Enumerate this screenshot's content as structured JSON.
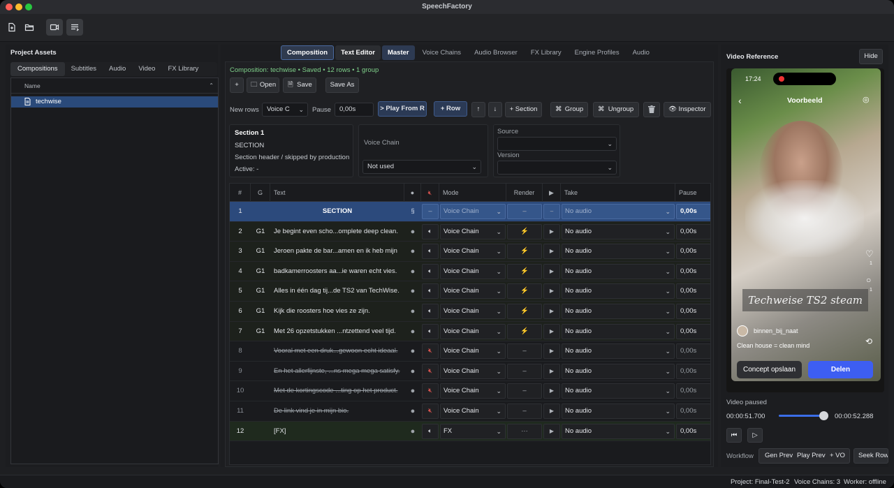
{
  "app": {
    "title": "SpeechFactory"
  },
  "colors": {
    "accent": "#3b6ee8",
    "status_green": "#7fd08a",
    "selected_row": "#2c4a7c",
    "fx_row": "#1f2a1e"
  },
  "toolbar": {
    "icons": [
      "new-file-icon",
      "open-folder-icon",
      "video-camera-icon",
      "list-icon"
    ]
  },
  "assets": {
    "title": "Project Assets",
    "tabs": [
      "Compositions",
      "Subtitles",
      "Audio",
      "Video",
      "FX Library"
    ],
    "column": "Name",
    "items": [
      "techwise"
    ]
  },
  "center": {
    "tabs": [
      "Composition",
      "Text Editor",
      "Master",
      "Voice Chains",
      "Audio Browser",
      "FX Library",
      "Engine Profiles",
      "Audio"
    ],
    "status": "Composition: techwise • Saved • 12 rows • 1 group",
    "buttons": {
      "plus": "+",
      "open": "Open",
      "save": "Save",
      "save_as": "Save As"
    },
    "newrows": {
      "label": "New rows",
      "voice_value": "Voice C",
      "pause_label": "Pause",
      "pause_value": "0,00s",
      "play_from": "> Play From R",
      "row": "+ Row",
      "up": "↑",
      "down": "↓",
      "section": "+ Section",
      "group": "Group",
      "ungroup": "Ungroup",
      "inspector": "Inspector"
    },
    "info": {
      "title": "Section 1",
      "type": "SECTION",
      "desc": "Section header / skipped by production",
      "active": "Active: -",
      "voice_chain_label": "Voice Chain",
      "voice_chain_value": "Not used",
      "source_label": "Source",
      "version_label": "Version"
    },
    "columns": [
      "#",
      "G",
      "Text",
      "Mode",
      "Render",
      "Take",
      "Pause"
    ],
    "rows": [
      {
        "n": "1",
        "g": "",
        "text": "SECTION",
        "mode": "Voice Chain",
        "render": "–",
        "take": "No audio",
        "pause": "0,00s",
        "kind": "section"
      },
      {
        "n": "2",
        "g": "G1",
        "text": "Je begint even scho...omplete deep clean.",
        "mode": "Voice Chain",
        "render": "⚡",
        "take": "No audio",
        "pause": "0,00s",
        "kind": "active"
      },
      {
        "n": "3",
        "g": "G1",
        "text": "Jeroen pakte de bar...amen en ik heb mijn",
        "mode": "Voice Chain",
        "render": "⚡",
        "take": "No audio",
        "pause": "0,00s",
        "kind": "active"
      },
      {
        "n": "4",
        "g": "G1",
        "text": "badkamerroosters aa...ie waren echt vies.",
        "mode": "Voice Chain",
        "render": "⚡",
        "take": "No audio",
        "pause": "0,00s",
        "kind": "active"
      },
      {
        "n": "5",
        "g": "G1",
        "text": "Alles in één dag tij...de TS2 van TechWise.",
        "mode": "Voice Chain",
        "render": "⚡",
        "take": "No audio",
        "pause": "0,00s",
        "kind": "active"
      },
      {
        "n": "6",
        "g": "G1",
        "text": "Kijk die roosters hoe vies ze zijn.",
        "mode": "Voice Chain",
        "render": "⚡",
        "take": "No audio",
        "pause": "0,00s",
        "kind": "active"
      },
      {
        "n": "7",
        "g": "G1",
        "text": "Met 26 opzetstukken ...ntzettend veel tijd.",
        "mode": "Voice Chain",
        "render": "⚡",
        "take": "No audio",
        "pause": "0,00s",
        "kind": "active"
      },
      {
        "n": "8",
        "g": "",
        "text": "Vooral met een druk...gewoon echt ideaal.",
        "mode": "Voice Chain",
        "render": "–",
        "take": "No audio",
        "pause": "0,00s",
        "kind": "muted"
      },
      {
        "n": "9",
        "g": "",
        "text": "En het allerfijnste, ...ns mega mega satisfy.",
        "mode": "Voice Chain",
        "render": "–",
        "take": "No audio",
        "pause": "0,00s",
        "kind": "muted"
      },
      {
        "n": "10",
        "g": "",
        "text": "Met de kortingscode ...ting op het product.",
        "mode": "Voice Chain",
        "render": "–",
        "take": "No audio",
        "pause": "0,00s",
        "kind": "muted"
      },
      {
        "n": "11",
        "g": "",
        "text": "De link vind je in mijn bio.",
        "mode": "Voice Chain",
        "render": "–",
        "take": "No audio",
        "pause": "0,00s",
        "kind": "muted"
      },
      {
        "n": "12",
        "g": "",
        "text": "[FX]",
        "mode": "FX",
        "render": "···",
        "take": "No audio",
        "pause": "0,00s",
        "kind": "fx"
      }
    ]
  },
  "video": {
    "title": "Video Reference",
    "hide": "Hide",
    "phone": {
      "time": "17:24",
      "header": "Voorbeeld",
      "caption": "Techweise TS2 steam",
      "user": "binnen_bij_naat",
      "desc": "Clean house = clean mind",
      "draft": "Concept opslaan",
      "share": "Delen",
      "count1": "1",
      "count2": "1"
    },
    "state": "Video paused",
    "current": "00:00:51.700",
    "duration": "00:00:52.288",
    "progress": 0.99,
    "workflow": {
      "label": "Workflow",
      "gen_prev": "Gen Prev",
      "play_prev": "Play Prev",
      "vo": "+ VO",
      "seek_row": "Seek Row"
    }
  },
  "statusbar": {
    "project": "Project: Final-Test-2",
    "chains": "Voice Chains: 3",
    "worker": "Worker: offline"
  }
}
